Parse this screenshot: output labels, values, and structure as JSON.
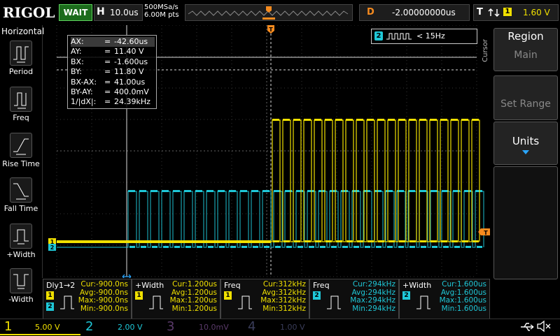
{
  "brand": "RIGOL",
  "status": "WAIT",
  "horizontal": {
    "key": "H",
    "value": "10.0us"
  },
  "sample": {
    "rate": "500MSa/s",
    "points": "6.00M pts"
  },
  "delay": {
    "key": "D",
    "value": "-2.00000000us"
  },
  "trigger": {
    "key": "T",
    "source": "1",
    "level": "1.60 V"
  },
  "left_menu": {
    "title": "Horizontal",
    "items": [
      {
        "label": "Period"
      },
      {
        "label": "Freq"
      },
      {
        "label": "Rise Time"
      },
      {
        "label": "Fall Time"
      },
      {
        "label": "+Width"
      },
      {
        "label": "-Width"
      }
    ]
  },
  "right_menu": {
    "side_label": "Cursor",
    "region_title": "Region",
    "region_value": "Main",
    "set_range": "Set Range",
    "units": "Units"
  },
  "cursor_table": [
    {
      "k": "AX:",
      "v": "-42.60us"
    },
    {
      "k": "AY:",
      "v": "11.40 V"
    },
    {
      "k": "BX:",
      "v": "-1.600us"
    },
    {
      "k": "BY:",
      "v": "11.80 V"
    },
    {
      "k": "BX-AX:",
      "v": "41.00us"
    },
    {
      "k": "BY-AY:",
      "v": "400.0mV"
    },
    {
      "k": "1/|dX|:",
      "v": "24.39kHz"
    }
  ],
  "cursor_eq": "=",
  "freq_counter": {
    "channel": "2",
    "value": "< 15Hz"
  },
  "markers": {
    "trigger": "T",
    "ch1": "1",
    "ch2": "2"
  },
  "measurements": [
    {
      "name": "Dly1→2",
      "ch": "1",
      "ch2": "2",
      "cur": "Cur:-900.0ns",
      "avg": "Avg:-900.0ns",
      "max": "Max:-900.0ns",
      "min": "Min:-900.0ns"
    },
    {
      "name": "+Width",
      "ch": "1",
      "cur": "Cur:1.200us",
      "avg": "Avg:1.200us",
      "max": "Max:1.200us",
      "min": "Min:1.200us"
    },
    {
      "name": "Freq",
      "ch": "1",
      "cur": "Cur:312kHz",
      "avg": "Avg:312kHz",
      "max": "Max:312kHz",
      "min": "Min:312kHz"
    },
    {
      "name": "Freq",
      "ch": "2",
      "cur": "Cur:294kHz",
      "avg": "Avg:294kHz",
      "max": "Max:294kHz",
      "min": "Min:294kHz"
    },
    {
      "name": "+Width",
      "ch": "2",
      "cur": "Cur:1.600us",
      "avg": "Avg:1.600us",
      "max": "Max:1.600us",
      "min": "Min:1.600us"
    }
  ],
  "channels": [
    {
      "n": "1",
      "scale": "5.00 V",
      "color": "#f0e000"
    },
    {
      "n": "2",
      "scale": "2.00 V",
      "color": "#1fc8d8"
    },
    {
      "n": "3",
      "scale": "10.0mV",
      "color": "#5a3a6a"
    },
    {
      "n": "4",
      "scale": "1.00 V",
      "color": "#3a3d5a"
    }
  ],
  "colors": {
    "ch1": "#f0e000",
    "ch2": "#1fc8d8",
    "trigger": "#f68b1f",
    "status": "#1c6b1c"
  }
}
